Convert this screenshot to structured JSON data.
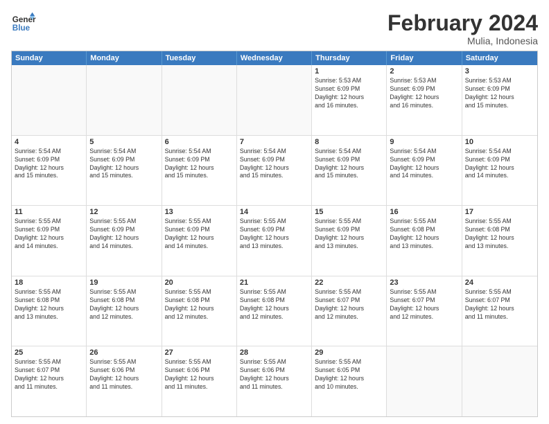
{
  "header": {
    "logo_line1": "General",
    "logo_line2": "Blue",
    "month_title": "February 2024",
    "location": "Mulia, Indonesia"
  },
  "days_of_week": [
    "Sunday",
    "Monday",
    "Tuesday",
    "Wednesday",
    "Thursday",
    "Friday",
    "Saturday"
  ],
  "weeks": [
    [
      {
        "day": "",
        "text": ""
      },
      {
        "day": "",
        "text": ""
      },
      {
        "day": "",
        "text": ""
      },
      {
        "day": "",
        "text": ""
      },
      {
        "day": "1",
        "text": "Sunrise: 5:53 AM\nSunset: 6:09 PM\nDaylight: 12 hours\nand 16 minutes."
      },
      {
        "day": "2",
        "text": "Sunrise: 5:53 AM\nSunset: 6:09 PM\nDaylight: 12 hours\nand 16 minutes."
      },
      {
        "day": "3",
        "text": "Sunrise: 5:53 AM\nSunset: 6:09 PM\nDaylight: 12 hours\nand 15 minutes."
      }
    ],
    [
      {
        "day": "4",
        "text": "Sunrise: 5:54 AM\nSunset: 6:09 PM\nDaylight: 12 hours\nand 15 minutes."
      },
      {
        "day": "5",
        "text": "Sunrise: 5:54 AM\nSunset: 6:09 PM\nDaylight: 12 hours\nand 15 minutes."
      },
      {
        "day": "6",
        "text": "Sunrise: 5:54 AM\nSunset: 6:09 PM\nDaylight: 12 hours\nand 15 minutes."
      },
      {
        "day": "7",
        "text": "Sunrise: 5:54 AM\nSunset: 6:09 PM\nDaylight: 12 hours\nand 15 minutes."
      },
      {
        "day": "8",
        "text": "Sunrise: 5:54 AM\nSunset: 6:09 PM\nDaylight: 12 hours\nand 15 minutes."
      },
      {
        "day": "9",
        "text": "Sunrise: 5:54 AM\nSunset: 6:09 PM\nDaylight: 12 hours\nand 14 minutes."
      },
      {
        "day": "10",
        "text": "Sunrise: 5:54 AM\nSunset: 6:09 PM\nDaylight: 12 hours\nand 14 minutes."
      }
    ],
    [
      {
        "day": "11",
        "text": "Sunrise: 5:55 AM\nSunset: 6:09 PM\nDaylight: 12 hours\nand 14 minutes."
      },
      {
        "day": "12",
        "text": "Sunrise: 5:55 AM\nSunset: 6:09 PM\nDaylight: 12 hours\nand 14 minutes."
      },
      {
        "day": "13",
        "text": "Sunrise: 5:55 AM\nSunset: 6:09 PM\nDaylight: 12 hours\nand 14 minutes."
      },
      {
        "day": "14",
        "text": "Sunrise: 5:55 AM\nSunset: 6:09 PM\nDaylight: 12 hours\nand 13 minutes."
      },
      {
        "day": "15",
        "text": "Sunrise: 5:55 AM\nSunset: 6:09 PM\nDaylight: 12 hours\nand 13 minutes."
      },
      {
        "day": "16",
        "text": "Sunrise: 5:55 AM\nSunset: 6:08 PM\nDaylight: 12 hours\nand 13 minutes."
      },
      {
        "day": "17",
        "text": "Sunrise: 5:55 AM\nSunset: 6:08 PM\nDaylight: 12 hours\nand 13 minutes."
      }
    ],
    [
      {
        "day": "18",
        "text": "Sunrise: 5:55 AM\nSunset: 6:08 PM\nDaylight: 12 hours\nand 13 minutes."
      },
      {
        "day": "19",
        "text": "Sunrise: 5:55 AM\nSunset: 6:08 PM\nDaylight: 12 hours\nand 12 minutes."
      },
      {
        "day": "20",
        "text": "Sunrise: 5:55 AM\nSunset: 6:08 PM\nDaylight: 12 hours\nand 12 minutes."
      },
      {
        "day": "21",
        "text": "Sunrise: 5:55 AM\nSunset: 6:08 PM\nDaylight: 12 hours\nand 12 minutes."
      },
      {
        "day": "22",
        "text": "Sunrise: 5:55 AM\nSunset: 6:07 PM\nDaylight: 12 hours\nand 12 minutes."
      },
      {
        "day": "23",
        "text": "Sunrise: 5:55 AM\nSunset: 6:07 PM\nDaylight: 12 hours\nand 12 minutes."
      },
      {
        "day": "24",
        "text": "Sunrise: 5:55 AM\nSunset: 6:07 PM\nDaylight: 12 hours\nand 11 minutes."
      }
    ],
    [
      {
        "day": "25",
        "text": "Sunrise: 5:55 AM\nSunset: 6:07 PM\nDaylight: 12 hours\nand 11 minutes."
      },
      {
        "day": "26",
        "text": "Sunrise: 5:55 AM\nSunset: 6:06 PM\nDaylight: 12 hours\nand 11 minutes."
      },
      {
        "day": "27",
        "text": "Sunrise: 5:55 AM\nSunset: 6:06 PM\nDaylight: 12 hours\nand 11 minutes."
      },
      {
        "day": "28",
        "text": "Sunrise: 5:55 AM\nSunset: 6:06 PM\nDaylight: 12 hours\nand 11 minutes."
      },
      {
        "day": "29",
        "text": "Sunrise: 5:55 AM\nSunset: 6:05 PM\nDaylight: 12 hours\nand 10 minutes."
      },
      {
        "day": "",
        "text": ""
      },
      {
        "day": "",
        "text": ""
      }
    ]
  ]
}
